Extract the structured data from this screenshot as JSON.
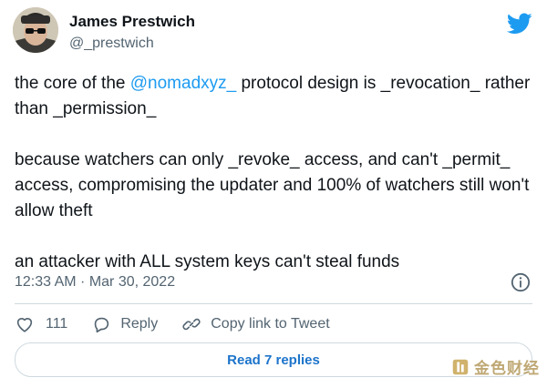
{
  "author": {
    "name": "James Prestwich",
    "handle": "@_prestwich"
  },
  "tweet": {
    "line1_pre": "the core of the ",
    "line1_mention": "@nomadxyz_",
    "line1_post": " protocol design is _revocation_ rather than _permission_",
    "paragraph2": "because watchers can only _revoke_ access, and can't _permit_ access, compromising the updater and 100% of watchers still won't allow theft",
    "paragraph3": "an attacker with ALL system keys can't steal funds"
  },
  "timestamp": "12:33 AM · Mar 30, 2022",
  "actions": {
    "like_count": "111",
    "reply_label": "Reply",
    "copy_link_label": "Copy link to Tweet"
  },
  "read_replies_label": "Read 7 replies",
  "watermark_text": "金色财经",
  "colors": {
    "accent": "#1d9bf0",
    "secondary_text": "#536471",
    "divider": "#cfd9de"
  },
  "icons": [
    "avatar",
    "twitter-bird-icon",
    "info-icon",
    "heart-icon",
    "reply-bubble-icon",
    "link-icon",
    "watermark-logo-icon"
  ]
}
